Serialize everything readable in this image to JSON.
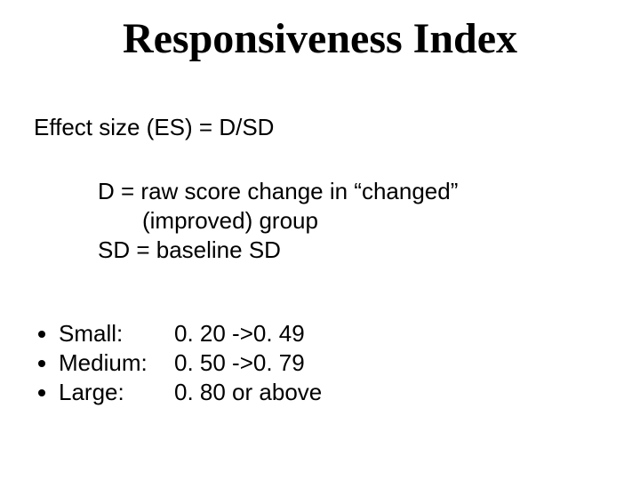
{
  "title": "Responsiveness Index",
  "formula": "Effect size (ES) = D/SD",
  "definitions": {
    "d_line1": "D  = raw score change in “changed”",
    "d_line2": "(improved) group",
    "sd": "SD  = baseline SD"
  },
  "categories": [
    {
      "label": "Small:",
      "range": "0. 20 ->0. 49"
    },
    {
      "label": "Medium:",
      "range": "0. 50 ->0. 79"
    },
    {
      "label": "Large:",
      "range": "0. 80 or above"
    }
  ]
}
